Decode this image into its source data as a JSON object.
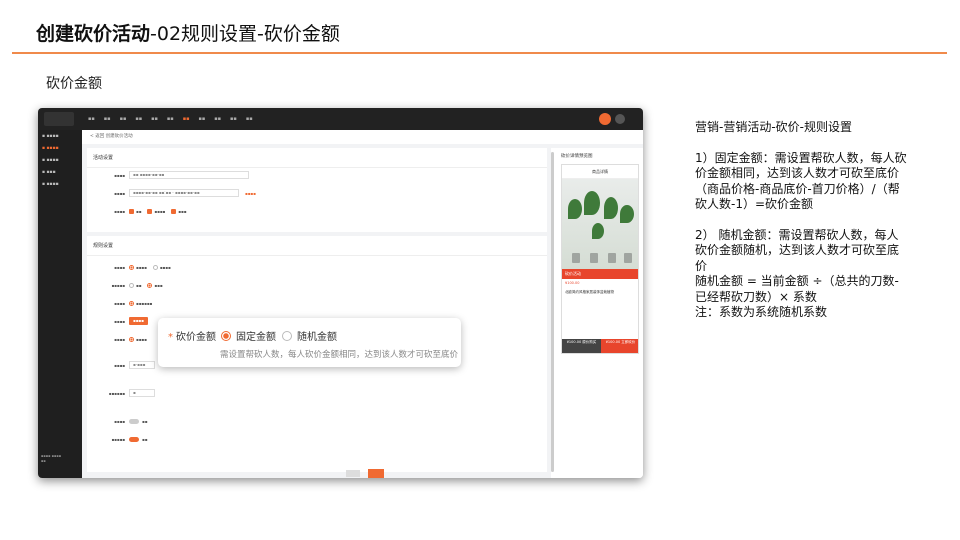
{
  "title": {
    "bold": "创建砍价活动",
    "rest": "-02规则设置-砍价金额"
  },
  "subtitle": "砍价金额",
  "colors": {
    "accent": "#f06a32",
    "rule": "#f08a4b",
    "dark_nav": "#222222"
  },
  "screenshot": {
    "crumb": "< 返回   创建砍价活动",
    "card1_header": "活动设置",
    "card2_header": "规则设置",
    "preview_title": "砍价详情预览图",
    "phone_header": "商品详情",
    "promo_bar": "砍价活动",
    "price_tag": "¥100.00",
    "product_desc": "北欧简约风格家居装饰盆栽植物",
    "foot_left": "¥100.00 原价购买",
    "foot_right": "¥100.00 立即砍价"
  },
  "popup": {
    "label_star": "*",
    "label": "砍价金额",
    "options": [
      {
        "label": "固定金额",
        "selected": true
      },
      {
        "label": "随机金额",
        "selected": false
      }
    ],
    "hint": "需设置帮砍人数，每人砍价金额相同，达到该人数才可砍至底价"
  },
  "notes": {
    "path": "营销-营销活动-砍价-规则设置",
    "p1": "1）固定金额：需设置帮砍人数，每人砍价金额相同，达到该人数才可砍至底价\n（商品价格-商品底价-首刀价格）/（帮砍人数-1）=砍价金额",
    "p2": "2） 随机金额：需设置帮砍人数，每人砍价金额随机，达到该人数才可砍至底价\n随机金额 = 当前金额 ÷（总共的刀数-已经帮砍刀数）× 系数\n注：系数为系统随机系数"
  }
}
